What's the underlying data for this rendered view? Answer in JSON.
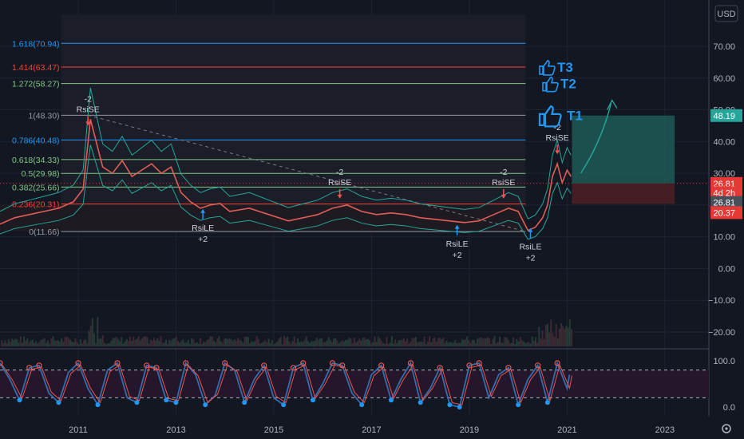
{
  "currency": "USD",
  "colors": {
    "background": "#131722",
    "grid": "#1f2330",
    "axis_text": "#b2b5be",
    "fib_blue": "#2196f3",
    "fib_red": "#f44336",
    "fib_green": "#81c784",
    "fib_gray": "#9598a1",
    "price_line": "#e25c56",
    "bollinger": "#26a69a",
    "stoch_k": "#2f6fb0",
    "stoch_d": "#ef5350",
    "target_teal": "#1e5f5a",
    "stop_red": "#4a1f25"
  },
  "fib_levels": [
    {
      "label": "1.618(70.94)",
      "value": 70.94,
      "color": "fib_blue"
    },
    {
      "label": "1.414(63.47)",
      "value": 63.47,
      "color": "fib_red"
    },
    {
      "label": "1.272(58.27)",
      "value": 58.27,
      "color": "fib_green"
    },
    {
      "label": "1(48.30)",
      "value": 48.3,
      "color": "fib_gray"
    },
    {
      "label": "0.786(40.48)",
      "value": 40.48,
      "color": "fib_blue"
    },
    {
      "label": "0.618(34.33)",
      "value": 34.33,
      "color": "fib_green"
    },
    {
      "label": "0.5(29.98)",
      "value": 29.98,
      "color": "fib_green"
    },
    {
      "label": "0.382(25.66)",
      "value": 25.66,
      "color": "fib_green"
    },
    {
      "label": "0.236(20.31)",
      "value": 20.31,
      "color": "fib_red"
    },
    {
      "label": "0(11.66)",
      "value": 11.66,
      "color": "fib_gray"
    }
  ],
  "targets": [
    {
      "label": "T3",
      "value": 63.47,
      "icon": "thumbs-up-icon"
    },
    {
      "label": "T2",
      "value": 58.27,
      "icon": "thumbs-up-icon"
    },
    {
      "label": "T1",
      "value": 48.3,
      "icon": "thumbs-up-icon"
    }
  ],
  "signals": [
    {
      "type": "short",
      "top": "-2",
      "bottom": "RsiSE",
      "date": 2011.2,
      "value": 45
    },
    {
      "type": "long",
      "top": "RsiLE",
      "bottom": "+2",
      "date": 2013.55,
      "value": 19
    },
    {
      "type": "short",
      "top": "-2",
      "bottom": "RsiSE",
      "date": 2016.35,
      "value": 22
    },
    {
      "type": "short",
      "top": "-2",
      "bottom": "RsiSE",
      "date": 2019.7,
      "value": 22
    },
    {
      "type": "long",
      "top": "RsiLE",
      "bottom": "+2",
      "date": 2018.75,
      "value": 14
    },
    {
      "type": "long",
      "top": "RsiLE",
      "bottom": "+2",
      "date": 2020.25,
      "value": 13
    },
    {
      "type": "short",
      "top": "-2",
      "bottom": "RsiSE",
      "date": 2020.8,
      "value": 36
    }
  ],
  "price_tags": [
    {
      "text": "48.19",
      "value": 48.19,
      "bg": "#26a69a"
    },
    {
      "text": "26.81",
      "value": 26.81,
      "bg": "#e53935"
    },
    {
      "text": "4d 2h",
      "value": 23.9,
      "bg": "#e53935"
    },
    {
      "text": "26.81",
      "value": 20.8,
      "bg": "#4a4e59"
    },
    {
      "text": "20.37",
      "value": 17.6,
      "bg": "#e53935"
    }
  ],
  "chart_data": {
    "type": "line",
    "title": "",
    "xlabel": "",
    "ylabel": "",
    "x_ticks": [
      "2011",
      "2013",
      "2015",
      "2017",
      "2019",
      "2021",
      "2023"
    ],
    "x_tick_values": [
      2011,
      2013,
      2015,
      2017,
      2019,
      2021,
      2023
    ],
    "xlim": [
      2009.4,
      2023.9
    ],
    "price_y_ticks": [
      "70.00",
      "60.00",
      "50.00",
      "40.00",
      "30.00",
      "20.00",
      "10.00",
      "0.00",
      "−10.00",
      "−20.00"
    ],
    "price_y_tick_values": [
      70,
      60,
      50,
      40,
      30,
      20,
      10,
      0,
      -10,
      -20
    ],
    "ylim": [
      -22,
      80
    ],
    "osc_y_ticks": [
      "100.0",
      "0.0"
    ],
    "osc_y_tick_values": [
      100,
      0
    ],
    "osc_ylim": [
      -8,
      108
    ],
    "osc_bands": [
      80,
      20
    ],
    "series": [
      {
        "x": [
          2009.4,
          2009.7,
          2010.0,
          2010.3,
          2010.6,
          2010.9,
          2011.1,
          2011.25,
          2011.35,
          2011.5,
          2011.7,
          2011.9,
          2012.1,
          2012.3,
          2012.5,
          2012.7,
          2012.9,
          2013.1,
          2013.3,
          2013.5,
          2013.7,
          2013.9,
          2014.1,
          2014.3,
          2014.5,
          2014.7,
          2014.9,
          2015.1,
          2015.3,
          2015.6,
          2015.9,
          2016.2,
          2016.5,
          2016.8,
          2017.1,
          2017.4,
          2017.7,
          2018.0,
          2018.3,
          2018.6,
          2018.9,
          2019.2,
          2019.5,
          2019.8,
          2020.0,
          2020.2,
          2020.35,
          2020.5,
          2020.6,
          2020.7,
          2020.8,
          2020.9,
          2021.0,
          2021.08
        ],
        "values": [
          14,
          16,
          17,
          18,
          19,
          21,
          25,
          47,
          41,
          32,
          30,
          34,
          29,
          31,
          33,
          30,
          32,
          24,
          21,
          19,
          20,
          20.5,
          18,
          18.5,
          19,
          18,
          17,
          16,
          15,
          16,
          17,
          19,
          20,
          18,
          17,
          17.5,
          17,
          16,
          15.5,
          15,
          14.5,
          15,
          17,
          19,
          18,
          12,
          13,
          16,
          20,
          29,
          33,
          27,
          31,
          29
        ]
      }
    ],
    "oscillator": [
      {
        "x": [
          2009.4,
          2009.6,
          2009.8,
          2010.0,
          2010.2,
          2010.4,
          2010.6,
          2010.8,
          2011.0,
          2011.2,
          2011.4,
          2011.6,
          2011.8,
          2012.0,
          2012.2,
          2012.4,
          2012.6,
          2012.8,
          2013.0,
          2013.2,
          2013.4,
          2013.6,
          2013.8,
          2014.0,
          2014.2,
          2014.4,
          2014.6,
          2014.8,
          2015.0,
          2015.2,
          2015.4,
          2015.6,
          2015.8,
          2016.0,
          2016.2,
          2016.4,
          2016.6,
          2016.8,
          2017.0,
          2017.2,
          2017.4,
          2017.6,
          2017.8,
          2018.0,
          2018.2,
          2018.4,
          2018.6,
          2018.8,
          2019.0,
          2019.2,
          2019.4,
          2019.6,
          2019.8,
          2020.0,
          2020.2,
          2020.4,
          2020.6,
          2020.8,
          2021.0,
          2021.05
        ],
        "values": [
          95,
          60,
          15,
          85,
          90,
          30,
          10,
          75,
          95,
          40,
          5,
          80,
          95,
          20,
          10,
          90,
          85,
          15,
          10,
          95,
          70,
          5,
          25,
          95,
          80,
          10,
          60,
          90,
          20,
          5,
          85,
          95,
          15,
          50,
          95,
          90,
          30,
          5,
          70,
          90,
          15,
          60,
          95,
          10,
          40,
          85,
          5,
          0,
          90,
          95,
          20,
          70,
          85,
          5,
          60,
          90,
          10,
          95,
          40,
          70
        ]
      }
    ]
  }
}
